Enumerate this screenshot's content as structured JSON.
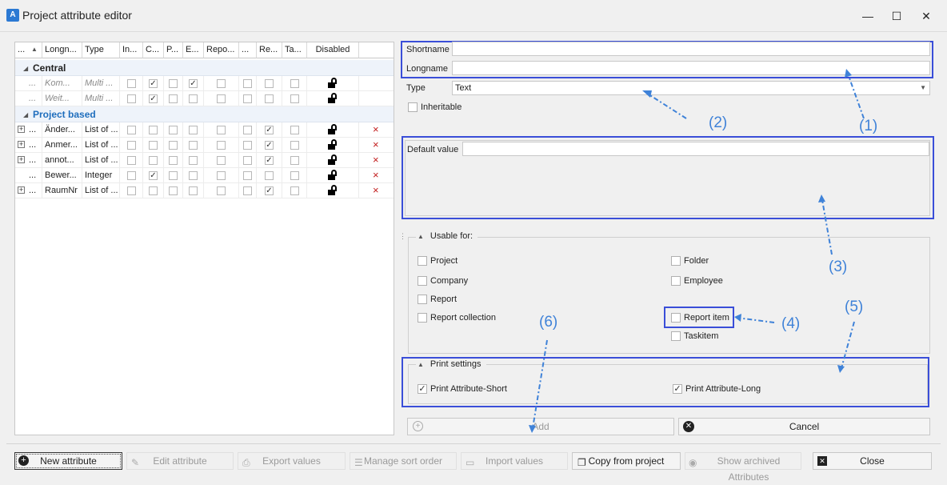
{
  "window": {
    "title": "Project attribute editor",
    "minimize": "—",
    "maximize": "☐",
    "close": "✕"
  },
  "grid": {
    "headers": [
      "...",
      "Longn...",
      "Type",
      "In...",
      "C...",
      "P...",
      "E...",
      "Repo...",
      "...",
      "Re...",
      "Ta...",
      "Disabled"
    ],
    "groups": [
      {
        "label": "Central",
        "rows": [
          {
            "expand": false,
            "c0": "...",
            "long": "Kom...",
            "type": "Multi ...",
            "checks": [
              false,
              true,
              false,
              true,
              false,
              false,
              false,
              false
            ],
            "delete": false,
            "italic": true
          },
          {
            "expand": false,
            "c0": "...",
            "long": "Weit...",
            "type": "Multi ...",
            "checks": [
              false,
              true,
              false,
              false,
              false,
              false,
              false,
              false
            ],
            "delete": false,
            "italic": true
          }
        ]
      },
      {
        "label": "Project based",
        "rows": [
          {
            "expand": true,
            "c0": "...",
            "long": "Änder...",
            "type": "List of ...",
            "checks": [
              false,
              false,
              false,
              false,
              false,
              false,
              true,
              false
            ],
            "delete": true,
            "italic": false
          },
          {
            "expand": true,
            "c0": "...",
            "long": "Anmer...",
            "type": "List of ...",
            "checks": [
              false,
              false,
              false,
              false,
              false,
              false,
              true,
              false
            ],
            "delete": true,
            "italic": false
          },
          {
            "expand": true,
            "c0": "...",
            "long": "annot...",
            "type": "List of ...",
            "checks": [
              false,
              false,
              false,
              false,
              false,
              false,
              true,
              false
            ],
            "delete": true,
            "italic": false
          },
          {
            "expand": false,
            "c0": "...",
            "long": "Bewer...",
            "type": "Integer",
            "checks": [
              false,
              true,
              false,
              false,
              false,
              false,
              false,
              false
            ],
            "delete": true,
            "italic": false
          },
          {
            "expand": true,
            "c0": "...",
            "long": "RaumNr",
            "type": "List of ...",
            "checks": [
              false,
              false,
              false,
              false,
              false,
              false,
              true,
              false
            ],
            "delete": true,
            "italic": false
          }
        ]
      }
    ]
  },
  "form": {
    "shortname_label": "Shortname",
    "shortname_value": "",
    "longname_label": "Longname",
    "longname_value": "",
    "type_label": "Type",
    "type_value": "Text",
    "inheritable_label": "Inheritable",
    "default_label": "Default value",
    "default_value": "",
    "usable_header": "Usable for:",
    "usable_left": [
      "Project",
      "Company",
      "Report",
      "Report collection"
    ],
    "usable_right": [
      "Folder",
      "Employee",
      "Report item",
      "Taskitem"
    ],
    "print_header": "Print settings",
    "print_short": "Print Attribute-Short",
    "print_long": "Print Attribute-Long",
    "add_label": "Add",
    "cancel_label": "Cancel"
  },
  "annotations": [
    "(1)",
    "(2)",
    "(3)",
    "(4)",
    "(5)",
    "(6)"
  ],
  "toolbar": {
    "new": "New attribute",
    "edit": "Edit attribute",
    "export": "Export values",
    "sort": "Manage sort order",
    "import": "Import values",
    "copy": "Copy from project",
    "archived": "Show archived Attributes",
    "close": "Close"
  },
  "colors": {
    "annotation_blue": "#3f82d8",
    "highlight_box": "#3a4ed8",
    "group_blue": "#1f6ebd",
    "delete_red": "#c21c1c"
  }
}
